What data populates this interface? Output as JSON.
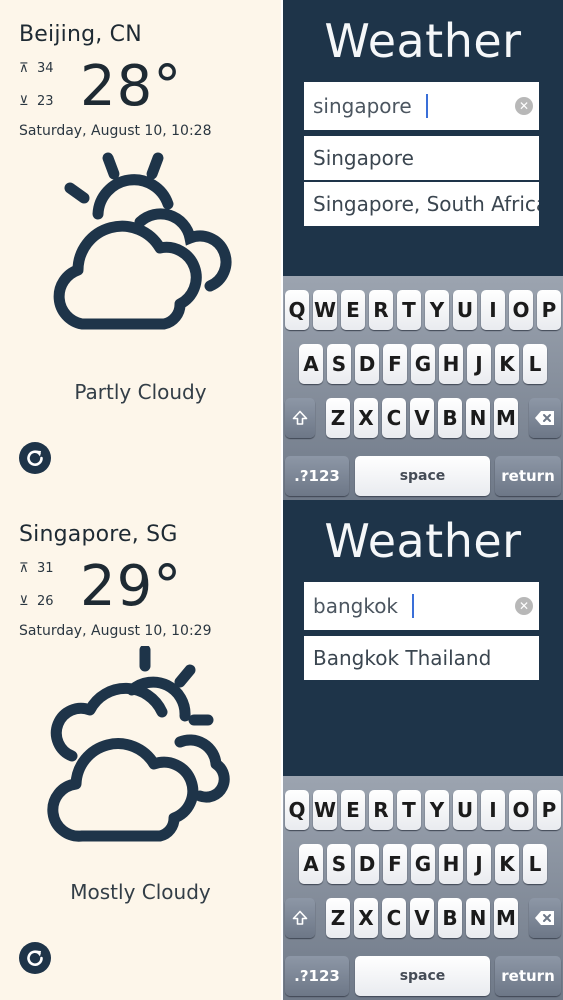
{
  "screens": [
    {
      "weather": {
        "city": "Beijing, CN",
        "high_arrow": "⊼",
        "high": "34",
        "low_arrow": "⊻",
        "low": "23",
        "temperature": "28°",
        "datetime": "Saturday, August 10, 10:28",
        "condition": "Partly Cloudy",
        "icon": "partly-cloudy-icon"
      },
      "search": {
        "title": "Weather",
        "query": "singapore",
        "suggestions": [
          "Singapore",
          "Singapore, South Africa"
        ]
      }
    },
    {
      "weather": {
        "city": "Singapore, SG",
        "high_arrow": "⊼",
        "high": "31",
        "low_arrow": "⊻",
        "low": "26",
        "temperature": "29°",
        "datetime": "Saturday, August 10, 10:29",
        "condition": "Mostly Cloudy",
        "icon": "mostly-cloudy-icon"
      },
      "search": {
        "title": "Weather",
        "query": "bangkok",
        "suggestions": [
          "Bangkok Thailand"
        ]
      }
    }
  ],
  "keyboard": {
    "row1": [
      "Q",
      "W",
      "E",
      "R",
      "T",
      "Y",
      "U",
      "I",
      "O",
      "P"
    ],
    "row2": [
      "A",
      "S",
      "D",
      "F",
      "G",
      "H",
      "J",
      "K",
      "L"
    ],
    "row3": [
      "Z",
      "X",
      "C",
      "V",
      "B",
      "N",
      "M"
    ],
    "shift_icon": "shift-icon",
    "backspace_icon": "backspace-icon",
    "numbers_label": ".?123",
    "space_label": "space",
    "return_label": "return"
  },
  "colors": {
    "weather_bg": "#fdf6ea",
    "search_bg": "#1e3449",
    "icon_stroke": "#1e3449"
  }
}
